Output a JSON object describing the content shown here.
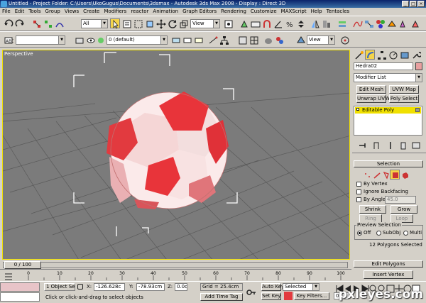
{
  "window": {
    "title": "Untitled    - Project Folder: C:\\Users\\UkoGugus\\Documents\\3dsmax    - Autodesk 3ds Max 2008    - Display : Direct 3D"
  },
  "menu": [
    "File",
    "Edit",
    "Tools",
    "Group",
    "Views",
    "Create",
    "Modifiers",
    "reactor",
    "Animation",
    "Graph Editors",
    "Rendering",
    "Customize",
    "MAXScript",
    "Help",
    "Tentacles"
  ],
  "toolbar": {
    "selection_filter": "All",
    "ref_coord": "View",
    "named_selection": "",
    "layer": "0 (default)",
    "view_combo": "View"
  },
  "viewport": {
    "label": "Perspective"
  },
  "command_panel": {
    "object_name": "Hedra02",
    "object_color": "#e8a0a0",
    "modifier_list": "Modifier List",
    "buttons": {
      "edit_mesh": "Edit Mesh",
      "uvw_map": "UVW Map",
      "unwrap_uvw": "Unwrap UVW",
      "poly_select": "Poly Select"
    },
    "stack": [
      "Editable Poly"
    ],
    "selection": {
      "title": "Selection",
      "by_vertex": "By Vertex",
      "ignore_backfacing": "Ignore Backfacing",
      "by_angle": "By Angle:",
      "angle_value": "45.0",
      "shrink": "Shrink",
      "grow": "Grow",
      "ring": "Ring",
      "loop": "Loop",
      "preview_title": "Preview Selection",
      "preview_options": [
        "Off",
        "SubObj",
        "Multi"
      ],
      "status": "12 Polygons Selected"
    },
    "edit_polygons_title": "Edit Polygons",
    "insert_vertex": "Insert Vertex"
  },
  "timeline": {
    "slider": "0 / 100",
    "ticks": [
      "0",
      "10",
      "20",
      "30",
      "40",
      "50",
      "60",
      "70",
      "80",
      "90",
      "100"
    ]
  },
  "status": {
    "selection": "1 Object Sele",
    "prompt": "Click or click-and-drag to select objects",
    "x": "-126.628c",
    "y": "-78.93cm",
    "z": "0.0cm",
    "grid": "Grid = 25.4cm",
    "add_time_tag": "Add Time Tag",
    "auto_key": "Auto Key",
    "set_key": "Set Key",
    "key_mode": "Selected",
    "key_filters": "Key Filters...",
    "frame": "0"
  },
  "watermark": "pxleyes.com",
  "colors": {
    "viewport_bg": "#7b7b7b",
    "ui_bg": "#d4d0c8",
    "highlight": "#f0e000",
    "ball_red": "#e8343a",
    "ball_white": "#fbeaea"
  }
}
